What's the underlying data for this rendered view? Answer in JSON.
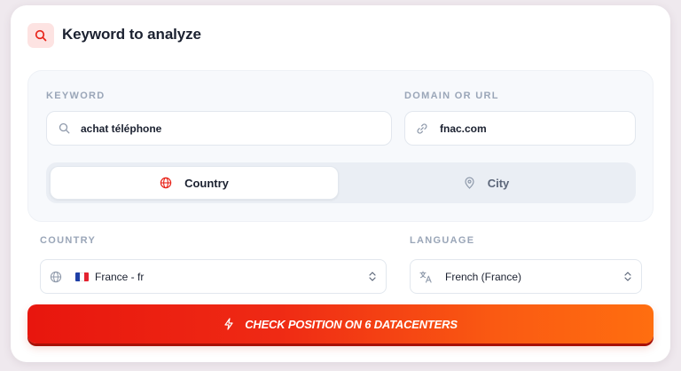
{
  "header": {
    "title": "Keyword to analyze",
    "icon": "search-icon"
  },
  "keyword": {
    "label": "KEYWORD",
    "value": "achat téléphone"
  },
  "domain": {
    "label": "DOMAIN OR URL",
    "value": "fnac.com"
  },
  "location_mode": {
    "options": [
      {
        "label": "Country",
        "icon": "globe-icon",
        "selected": true
      },
      {
        "label": "City",
        "icon": "map-pin-icon",
        "selected": false
      }
    ]
  },
  "country": {
    "label": "COUNTRY",
    "value": "France - fr",
    "flag": [
      "#1f3fa6",
      "#ffffff",
      "#e3222f"
    ]
  },
  "language": {
    "label": "LANGUAGE",
    "value": "French (France)"
  },
  "cta": {
    "label": "CHECK POSITION ON 6 DATACENTERS",
    "icon": "lightning-icon"
  },
  "colors": {
    "accent": "#e8160e",
    "accent_end": "#ff6e10",
    "text": "#1b2130",
    "muted": "#9aa6b8"
  }
}
